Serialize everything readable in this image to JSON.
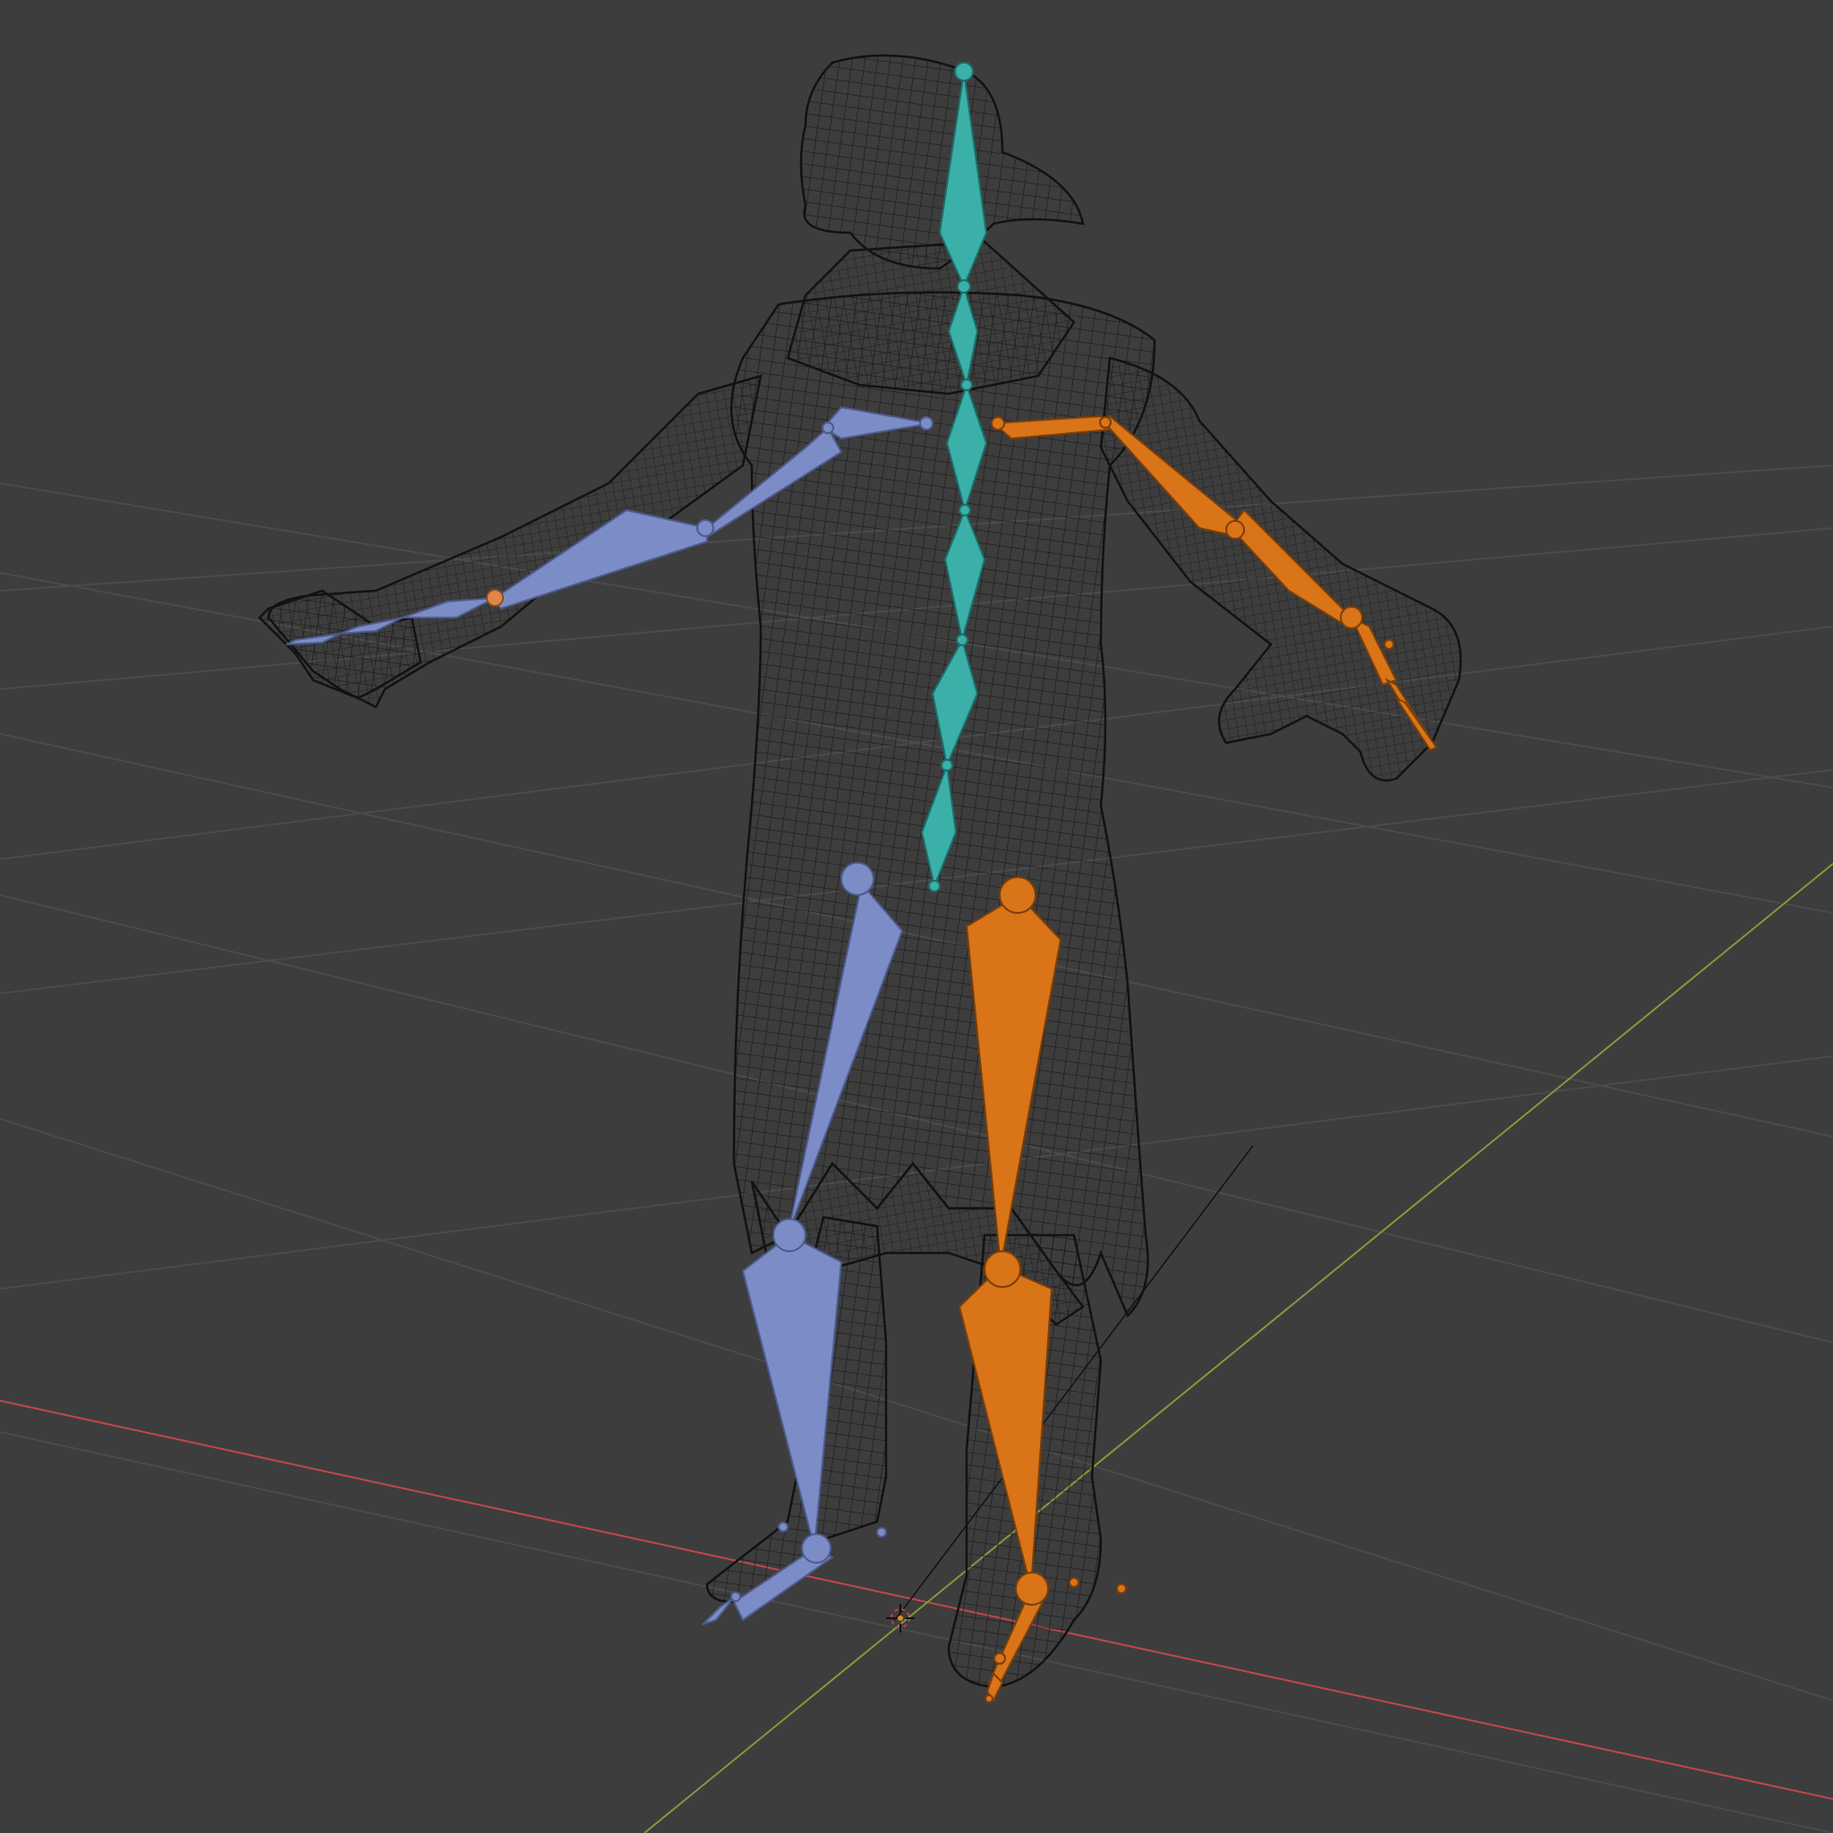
{
  "viewport": {
    "background": "#3d3d3d",
    "grid_color": "#4a4a4a",
    "x_axis_color": "#c0474a",
    "y_axis_color": "#7f9c3a"
  },
  "armature": {
    "spine_color": "#3bb0a8",
    "left_side_color": "#7c8cc6",
    "right_side_color": "#d97418"
  },
  "mesh": {
    "wire_color": "#111111"
  }
}
